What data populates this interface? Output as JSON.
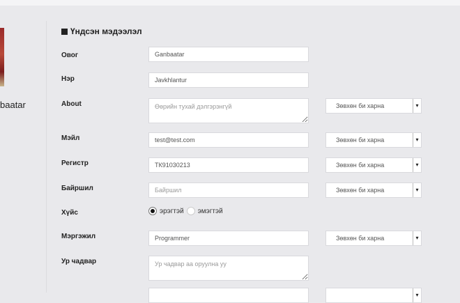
{
  "profile": {
    "name_partial": "baatar"
  },
  "section": {
    "title": "Үндсэн мэдээлэл"
  },
  "visibility_label": "Зөвхөн би харна",
  "fields": {
    "lastname": {
      "label": "Овог",
      "value": "Ganbaatar"
    },
    "firstname": {
      "label": "Нэр",
      "value": "Javkhlantur"
    },
    "about": {
      "label": "About",
      "placeholder": "Өөрийн тухай дэлгэрэнгүй"
    },
    "email": {
      "label": "Мэйл",
      "value": "test@test.com"
    },
    "register": {
      "label": "Регистр",
      "value": "ТК91030213"
    },
    "location": {
      "label": "Байршил",
      "placeholder": "Байршил"
    },
    "gender": {
      "label": "Хүйс",
      "options": [
        "эрэгтэй",
        "эмэгтэй"
      ],
      "selected": "эрэгтэй"
    },
    "profession": {
      "label": "Мэргэжил",
      "value": "Programmer"
    },
    "skills": {
      "label": "Ур чадвар",
      "placeholder": "Ур чадвар аа оруулна уу"
    }
  }
}
